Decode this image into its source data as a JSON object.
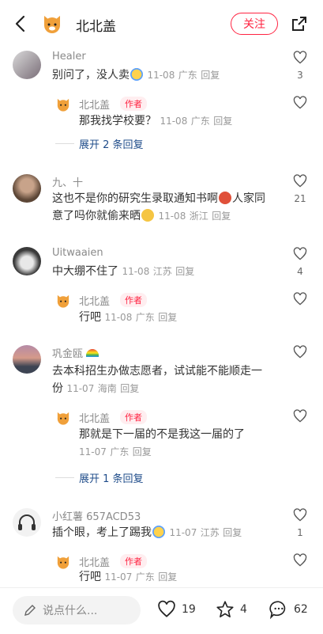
{
  "header": {
    "title": "北北盖",
    "follow_label": "关注"
  },
  "comments": [
    {
      "user": "Healer",
      "text": "别问了，没人卖",
      "date": "11-08",
      "location": "广东",
      "reply_label": "回复",
      "likes": "3",
      "replies": [
        {
          "user": "北北盖",
          "tag": "作者",
          "text": "那我找学校要？",
          "date": "11-08",
          "location": "广东",
          "reply_label": "回复"
        }
      ],
      "expand_label": "展开 2 条回复"
    },
    {
      "user": "九、十",
      "text_line1": "这也不是你的研究生录取通知书啊",
      "text_line1b": "人家同",
      "text_line2": "意了吗你就偷来晒",
      "date": "11-08",
      "location": "浙江",
      "reply_label": "回复",
      "likes": "21"
    },
    {
      "user": "Uitwaaien",
      "text": "中大绷不住了",
      "date": "11-08",
      "location": "江苏",
      "reply_label": "回复",
      "likes": "4",
      "replies": [
        {
          "user": "北北盖",
          "tag": "作者",
          "text": "行吧",
          "date": "11-08",
          "location": "广东",
          "reply_label": "回复"
        }
      ]
    },
    {
      "user": "巩金瓯",
      "text_line1": "去本科招生办做志愿者，试试能不能顺走一",
      "text_line2": "份",
      "date": "11-07",
      "location": "海南",
      "reply_label": "回复",
      "replies": [
        {
          "user": "北北盖",
          "tag": "作者",
          "text": "那就是下一届的不是我这一届的了",
          "date": "11-07",
          "location": "广东",
          "reply_label": "回复"
        }
      ],
      "expand_label": "展开 1 条回复"
    },
    {
      "user": "小红薯 657ACD53",
      "text": "插个眼，考上了踢我",
      "date": "11-07",
      "location": "江苏",
      "reply_label": "回复",
      "likes": "1",
      "replies": [
        {
          "user": "北北盖",
          "tag": "作者",
          "text": "行吧",
          "date": "11-07",
          "location": "广东",
          "reply_label": "回复"
        }
      ]
    }
  ],
  "bottom": {
    "input_placeholder": "说点什么...",
    "likes": "19",
    "stars": "4",
    "comments": "62"
  },
  "colors": {
    "accent": "#ff2442",
    "link": "#1f4c8a"
  }
}
